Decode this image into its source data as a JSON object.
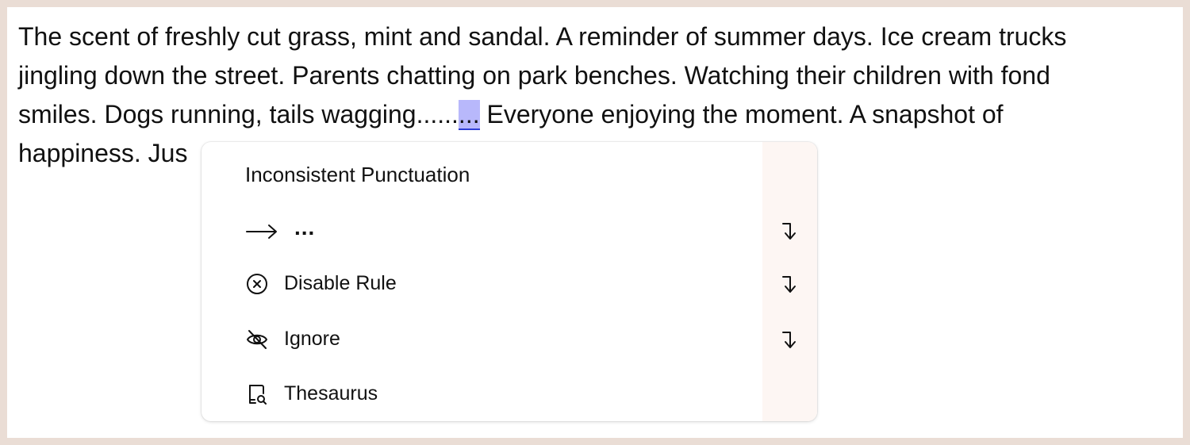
{
  "document": {
    "lines": [
      "The scent of freshly cut grass, mint and sandal. A reminder of summer days. Ice cream trucks",
      "jingling down the street. Parents chatting on park benches. Watching their children with fond"
    ],
    "line3_before": "smiles. Dogs running, tails wagging......",
    "line3_highlight": "...",
    "line3_after": " Everyone enjoying the moment. A snapshot of",
    "line4_visible": "happiness. Jus"
  },
  "popup": {
    "title": "Inconsistent Punctuation",
    "suggestion": "...",
    "items": [
      {
        "label": "Disable Rule",
        "icon": "circle-x-icon"
      },
      {
        "label": "Ignore",
        "icon": "eye-off-icon"
      },
      {
        "label": "Thesaurus",
        "icon": "thesaurus-icon"
      }
    ],
    "suggestion_icon": "arrow-right-icon",
    "shortcut_icon": "enter-return-icon"
  },
  "colors": {
    "frame_background": "#eaddd5",
    "editor_background": "#ffffff",
    "highlight_fill": "#b8b8fb",
    "highlight_underline": "#2f3fd6",
    "popup_side_panel": "#fdf6f3"
  }
}
